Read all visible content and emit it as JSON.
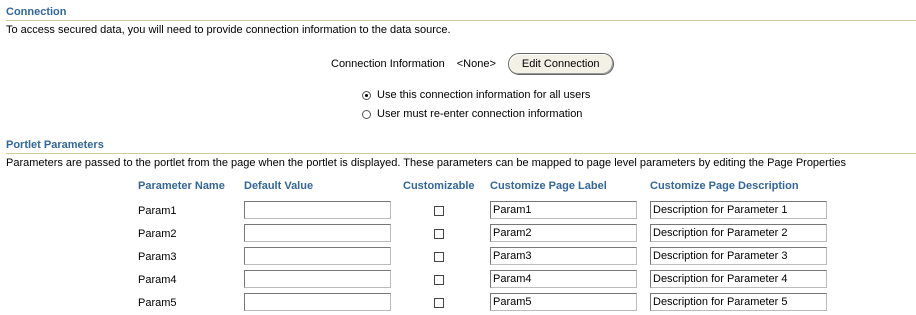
{
  "connection": {
    "title": "Connection",
    "description": "To access secured data, you will need to provide connection information to the data source.",
    "info_label": "Connection Information",
    "info_value": "<None>",
    "edit_button": "Edit Connection",
    "radio_all_users": "Use this connection information for all users",
    "radio_reenter": "User must re-enter connection information",
    "selected_option": "all_users"
  },
  "portlet": {
    "title": "Portlet Parameters",
    "description": "Parameters are passed to the portlet from the page when the portlet is displayed. These parameters can be mapped to page level parameters by editing the Page Properties",
    "headers": {
      "name": "Parameter Name",
      "default": "Default Value",
      "customizable": "Customizable",
      "label": "Customize Page Label",
      "desc": "Customize Page Description"
    },
    "rows": [
      {
        "name": "Param1",
        "default": "",
        "customizable": false,
        "label": "Param1",
        "desc": "Description for Parameter 1"
      },
      {
        "name": "Param2",
        "default": "",
        "customizable": false,
        "label": "Param2",
        "desc": "Description for Parameter 2"
      },
      {
        "name": "Param3",
        "default": "",
        "customizable": false,
        "label": "Param3",
        "desc": "Description for Parameter 3"
      },
      {
        "name": "Param4",
        "default": "",
        "customizable": false,
        "label": "Param4",
        "desc": "Description for Parameter 4"
      },
      {
        "name": "Param5",
        "default": "",
        "customizable": false,
        "label": "Param5",
        "desc": "Description for Parameter 5"
      }
    ]
  },
  "colors": {
    "heading": "#336699",
    "rule": "#cccc99"
  }
}
